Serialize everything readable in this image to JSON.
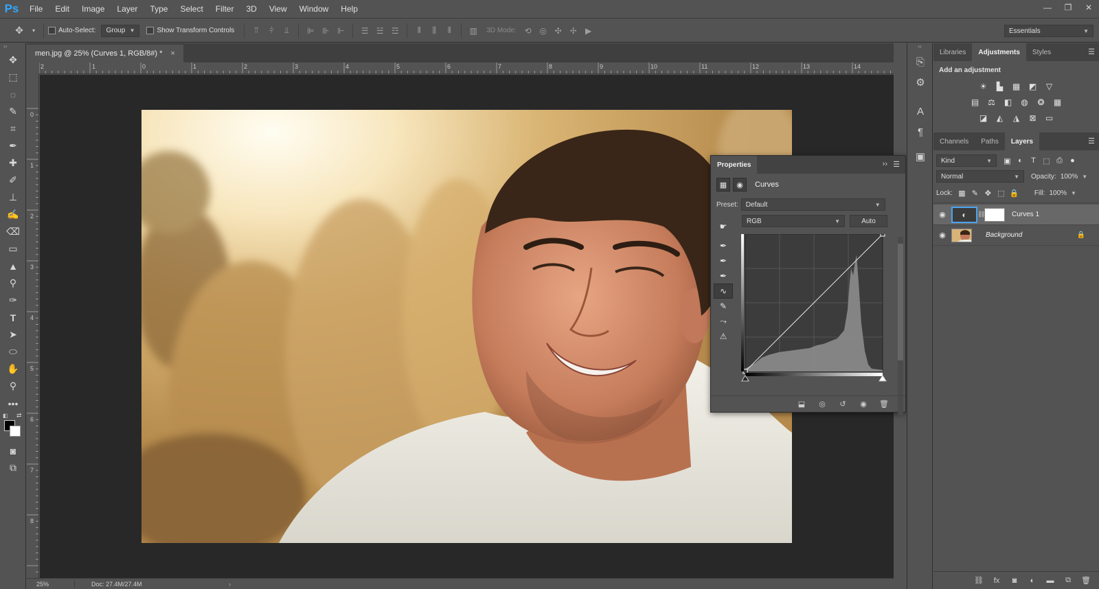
{
  "app": {
    "logo": "Ps",
    "menu": [
      "File",
      "Edit",
      "Image",
      "Layer",
      "Type",
      "Select",
      "Filter",
      "3D",
      "View",
      "Window",
      "Help"
    ]
  },
  "window_controls": [
    "—",
    "❐",
    "✕"
  ],
  "options_bar": {
    "auto_select_label": "Auto-Select:",
    "auto_select_target": "Group",
    "show_transform_label": "Show Transform Controls",
    "three_d_mode_label": "3D Mode:",
    "workspace": "Essentials"
  },
  "document": {
    "tab_title": "men.jpg @ 25% (Curves 1, RGB/8#) *",
    "close_glyph": "×",
    "ruler_h_labels": [
      "2",
      "1",
      "0",
      "1",
      "2",
      "3",
      "4",
      "5",
      "6",
      "7",
      "8",
      "9",
      "10",
      "11",
      "12",
      "13",
      "14"
    ],
    "ruler_v_labels": [
      "0",
      "1",
      "2",
      "3",
      "4",
      "5",
      "6",
      "7",
      "8"
    ]
  },
  "status": {
    "zoom": "25%",
    "doc_size": "Doc: 27.4M/27.4M",
    "arrow": "›"
  },
  "right_panels": {
    "top_tabs": [
      "Libraries",
      "Adjustments",
      "Styles"
    ],
    "top_active": "Adjustments",
    "add_adjustment_title": "Add an adjustment",
    "layer_tabs": [
      "Channels",
      "Paths",
      "Layers"
    ],
    "layer_active": "Layers",
    "kind_filter": "Kind",
    "blend_mode": "Normal",
    "opacity_label": "Opacity:",
    "opacity_value": "100%",
    "lock_label": "Lock:",
    "fill_label": "Fill:",
    "fill_value": "100%",
    "layers": [
      {
        "name": "Curves 1",
        "type": "adjustment",
        "selected": true
      },
      {
        "name": "Background",
        "type": "background",
        "selected": false
      }
    ]
  },
  "properties_panel": {
    "title": "Properties",
    "adjustment_name": "Curves",
    "preset_label": "Preset:",
    "preset_value": "Default",
    "channel_value": "RGB",
    "auto_button": "Auto"
  }
}
